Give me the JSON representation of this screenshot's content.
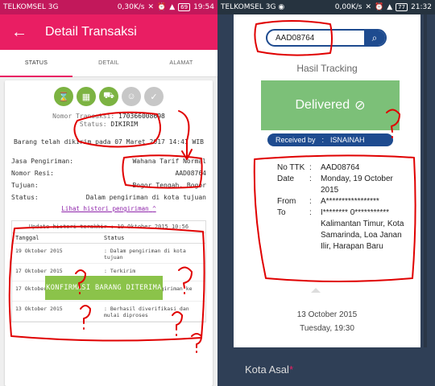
{
  "left": {
    "status_bar": {
      "carrier": "TELKOMSEL 3G",
      "speed": "0,30K/s",
      "battery": "69",
      "time": "19:54"
    },
    "app_bar": {
      "back_icon": "arrow-left-icon",
      "title": "Detail Transaksi"
    },
    "tabs": [
      {
        "label": "STATUS"
      },
      {
        "label": "DETAIL"
      },
      {
        "label": "ALAMAT"
      }
    ],
    "transaction": {
      "nomor_label": "Nomor Transaksi:",
      "nomor_value": "170366008698",
      "status_label": "Status:",
      "status_value": "DIKIRIM",
      "sent_text": "Barang telah dikirim pada 07 Maret 2017 14:41 WIB"
    },
    "info": [
      {
        "label": "Jasa Pengiriman:",
        "value": "Wahana Tarif Normal"
      },
      {
        "label": "Nomor Resi:",
        "value": "AAD08764"
      },
      {
        "label": "Tujuan:",
        "value": "Bogor Tengah, Bogor"
      },
      {
        "label": "Status:",
        "value": "Dalam pengiriman di kota tujuan"
      }
    ],
    "history_link": "Lihat histori pengiriman",
    "history": {
      "updated": "Update histori terakhir : 19 Oktober 2015 10:56",
      "col_date": "Tanggal",
      "col_status": "Status",
      "rows": [
        {
          "date": "19 Oktober 2015",
          "status": ": Dalam pengiriman di kota tujuan"
        },
        {
          "date": "17 Oktober 2015",
          "status": ": Terkirim"
        },
        {
          "date": "17 Oktober 2015",
          "status": ": Dalam proses pengiriman ke kota tujuan"
        },
        {
          "date": "13 Oktober 2015",
          "status": ": Berhasil diverifikasi dan mulai diproses"
        }
      ]
    },
    "confirm_button": "KONFIRMASI BARANG DITERIMA"
  },
  "right": {
    "status_bar": {
      "carrier": "TELKOMSEL 3G",
      "speed": "0,00K/s",
      "battery": "77",
      "time": "21:32"
    },
    "search": {
      "value": "AAD08764",
      "icon": "search-icon"
    },
    "tracking_title": "Hasil Tracking",
    "delivered": "Delivered",
    "received_by_label": "Received by",
    "received_by_sep": ":",
    "received_by_value": "ISNAINAH",
    "tracking": [
      {
        "key": "No TTK",
        "sep": ":",
        "value": "AAD08764"
      },
      {
        "key": "Date",
        "sep": ":",
        "value": "Monday, 19 October 2015"
      },
      {
        "key": "From",
        "sep": ":",
        "value": "A*****************"
      },
      {
        "key": "To",
        "sep": ":",
        "value": "I******** 0*********** Kalimantan Timur, Kota Samarinda, Loa Janan Ilir, Harapan Baru"
      }
    ],
    "date": "13 October 2015",
    "time": "Tuesday, 19:30",
    "kota_asal": "Kota Asal",
    "kota_star": "*"
  },
  "colors": {
    "primary": "#e91e63",
    "success": "#7cb342",
    "annotation": "#e00000",
    "navy": "#1e4b8f"
  }
}
